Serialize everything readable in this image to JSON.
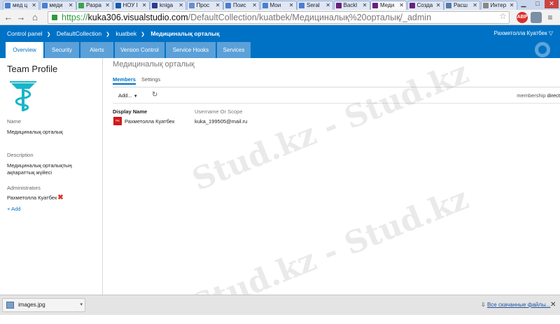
{
  "browser": {
    "tabs": [
      {
        "label": "мед ц",
        "color": "#4a7fd0"
      },
      {
        "label": "меди",
        "color": "#4a7fd0"
      },
      {
        "label": "Разра",
        "color": "#3ca24d"
      },
      {
        "label": "НОУ І",
        "color": "#1a5aa8"
      },
      {
        "label": "kniga",
        "color": "#2d3c8c"
      },
      {
        "label": "Прос",
        "color": "#6a8ec9"
      },
      {
        "label": "Поис",
        "color": "#4a7fd0"
      },
      {
        "label": "Мои",
        "color": "#4a7fd0"
      },
      {
        "label": "Seral",
        "color": "#4a7fd0"
      },
      {
        "label": "Backl",
        "color": "#68217a"
      },
      {
        "label": "Меди",
        "color": "#68217a"
      },
      {
        "label": "Созда",
        "color": "#68217a"
      },
      {
        "label": "Расш",
        "color": "#557ba8"
      },
      {
        "label": "Интер",
        "color": "#888888"
      }
    ],
    "tab_close": "✕",
    "url": {
      "scheme": "https://",
      "host": "kuka306.visualstudio.com",
      "path": "/DefaultCollection/kuatbek/Медициналық%20орталық/_admin"
    },
    "extensions": [
      {
        "label": "ABP",
        "color": "#d9302a"
      },
      {
        "label": "",
        "color": "#7b8fa6"
      }
    ]
  },
  "header": {
    "breadcrumbs": [
      "Control panel",
      "DefaultCollection",
      "kuatbek",
      "Медициналық орталық"
    ],
    "user_name": "Рахметолла Куатбек",
    "hubs": [
      "Overview",
      "Security",
      "Alerts",
      "Version Control",
      "Service Hooks",
      "Services"
    ],
    "active_hub": "Overview"
  },
  "left": {
    "title": "Team Profile",
    "name_label": "Name",
    "name_value": "Медициналық орталық",
    "description_label": "Description",
    "description_value": "Медициналық орталықтың ақпараттық жүйесі",
    "admins_label": "Administrators",
    "admin_name": "Рахметолла Куатбек",
    "remove_glyph": "✖",
    "add_link": "+ Add"
  },
  "main": {
    "title": "Медициналық орталық",
    "tabs": [
      "Members",
      "Settings"
    ],
    "active_tab": "Members",
    "add_button": "Add...",
    "membership_label": "membership",
    "membership_value": "direct",
    "columns": [
      "Display Name",
      "Username Or Scope"
    ],
    "rows": [
      {
        "initials": "РК",
        "display_name": "Рахметолла Куатбек",
        "username": "kuka_199505@mail.ru"
      }
    ]
  },
  "downloads": {
    "file": "images.jpg",
    "show_all": "Все скачанные файлы..."
  },
  "watermark": {
    "text": "Stud.kz - Stud.kz"
  },
  "colors": {
    "brand": "#0072c6",
    "hub_inactive": "#5ba0d8",
    "avatar": "#d01919"
  }
}
